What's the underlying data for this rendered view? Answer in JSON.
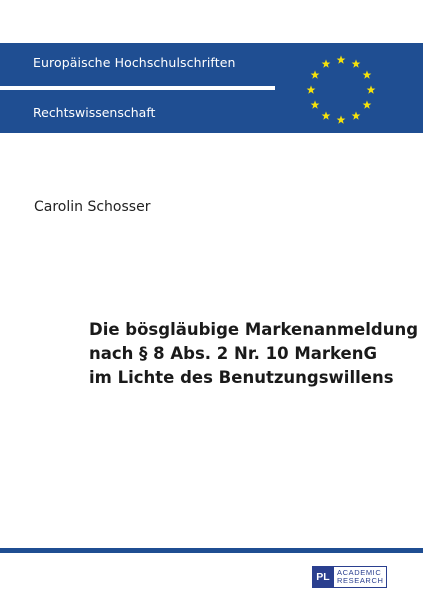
{
  "series": {
    "title": "Europäische Hochschulschriften",
    "subtitle": "Rechtswissenschaft",
    "band_color": "#1f4e92",
    "star_color": "#f5e10b",
    "stars_icon": "eu-stars-circle-icon"
  },
  "author": "Carolin Schosser",
  "title_lines": [
    "Die bösgläubige Markenanmeldung",
    "nach § 8 Abs. 2 Nr. 10 MarkenG",
    "im Lichte des Benutzungswillens"
  ],
  "publisher": {
    "logo_letters": "PL",
    "line1": "ACADEMIC",
    "line2": "RESEARCH"
  }
}
